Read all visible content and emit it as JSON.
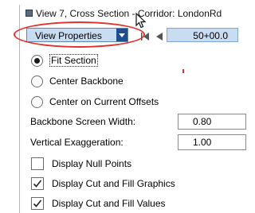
{
  "window": {
    "title": "View 7, Cross Section - Corridor: LondonRd",
    "icon": "view-window-icon"
  },
  "toolbar": {
    "view_dropdown_label": "View Properties",
    "coordinate_value": "50+00.0"
  },
  "radio_options": [
    {
      "label": "Fit Section",
      "checked": true
    },
    {
      "label": "Center Backbone",
      "checked": false
    },
    {
      "label": "Center on Current Offsets",
      "checked": false
    }
  ],
  "fields": [
    {
      "label": "Backbone Screen Width:",
      "value": "0.80"
    },
    {
      "label": "Vertical Exaggeration:",
      "value": "1.00"
    }
  ],
  "checkboxes": [
    {
      "label": "Display Null Points",
      "checked": false
    },
    {
      "label": "Display Cut and Fill Graphics",
      "checked": true
    },
    {
      "label": "Display Cut and Fill Values",
      "checked": true
    }
  ],
  "colors": {
    "highlight_ring": "#e2312e",
    "dropdown_bg": "#c9ddf2",
    "dropdown_button": "#1c4f91"
  }
}
